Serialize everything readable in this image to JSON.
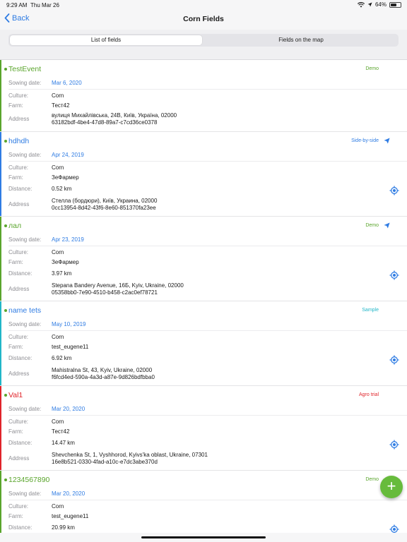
{
  "status_bar": {
    "time": "9:29 AM",
    "date": "Thu Mar 26",
    "battery": "64%",
    "battery_level": 0.64
  },
  "nav": {
    "back_label": "Back",
    "title": "Corn Fields"
  },
  "tabs": [
    {
      "label": "List of fields",
      "selected": true
    },
    {
      "label": "Fields on the map",
      "selected": false
    }
  ],
  "labels": {
    "sowing": "Sowing date:",
    "culture": "Culture:",
    "farm": "Farm:",
    "distance": "Distance:",
    "address": "Address"
  },
  "colors": {
    "green": "#5aa52c",
    "blue": "#2f7ce3",
    "cyan": "#21b6c8",
    "red": "#e0242a",
    "accent": "#2f7ce3",
    "fab": "#67bb3c"
  },
  "fields": [
    {
      "name": "TestEvent",
      "color": "#5aa52c",
      "badge": "Demo",
      "badge_color": "#5aa52c",
      "sowing_date": "Mar 6, 2020",
      "culture": "Corn",
      "farm": "Тест42",
      "address_line1": "вулиця Михайлівська, 24В, Київ, Україна, 02000",
      "address_line2": "63182bdf-4be4-47d8-89a7-c7cd36ce0378"
    },
    {
      "name": "hdhdh",
      "color": "#2f7ce3",
      "badge": "Side-by-side",
      "badge_color": "#2f7ce3",
      "send_icon": "paper-plane-icon",
      "sowing_date": "Apr 24, 2019",
      "culture": "Corn",
      "farm": "ЗеФармер",
      "distance": "0.52 km",
      "address_line1": "Стелла (бордюри), Київ, Украина, 02000",
      "address_line2": "0cc13954-8d42-43f6-8e60-851370fa23ee"
    },
    {
      "name": "лал",
      "color": "#5aa52c",
      "badge": "Demo",
      "badge_color": "#5aa52c",
      "send_icon": "paper-plane-icon",
      "sowing_date": "Apr 23, 2019",
      "culture": "Corn",
      "farm": "ЗеФармер",
      "distance": "3.97 km",
      "address_line1": "Stepana Bandery Avenue, 16Б, Kyiv, Ukraine, 02000",
      "address_line2": "05358bb0-7e90-4510-b458-c2ac0ef78721"
    },
    {
      "name": "name tets",
      "color": "#21b6c8",
      "badge": "Sample",
      "badge_color": "#21b6c8",
      "sowing_date": "May 10, 2019",
      "culture": "Corn",
      "farm": "test_eugene11",
      "distance": "6.92 km",
      "address_line1": "Mahistralna St, 43, Kyiv, Ukraine, 02000",
      "address_line2": "f6fcd4ed-590a-4a3d-a87e-9d826bdfbba0"
    },
    {
      "name": "Val1",
      "color": "#e0242a",
      "badge": "Agro trial",
      "badge_color": "#e0242a",
      "sowing_date": "Mar 20, 2020",
      "culture": "Corn",
      "farm": "Тест42",
      "distance": "14.47 km",
      "address_line1": "Shevchenka St, 1, Vyshhorod, Kyivs'ka oblast, Ukraine, 07301",
      "address_line2": "16e8b521-0330-4fad-a10c-e7dc3abe370d"
    },
    {
      "name": "1234567890",
      "color": "#5aa52c",
      "badge": "Demo",
      "badge_color": "#5aa52c",
      "sowing_date": "Mar 20, 2020",
      "culture": "Corn",
      "farm": "test_eugene11",
      "distance": "20.99 km"
    }
  ],
  "fab": {
    "label": "+",
    "icon": "plus-icon"
  }
}
